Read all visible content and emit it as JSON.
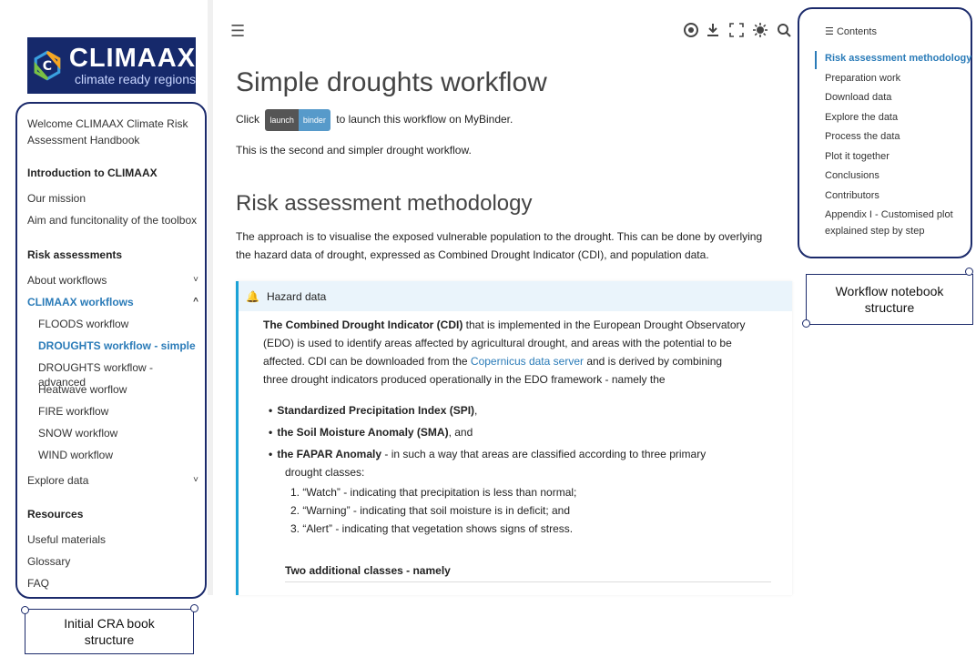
{
  "logo": {
    "title": "CLIMAAX",
    "subtitle": "climate ready regions"
  },
  "sidebar": {
    "items": [
      {
        "label": "Welcome CLIMAAX Climate Risk",
        "style": "normal"
      },
      {
        "label": "Assessment Handbook",
        "style": "normal"
      },
      {
        "label": "Introduction to CLIMAAX",
        "style": "bold"
      },
      {
        "label": "Our mission",
        "style": "normal"
      },
      {
        "label": "Aim and funcitonality of the toolbox",
        "style": "normal"
      },
      {
        "label": "Risk assessments",
        "style": "bold"
      },
      {
        "label": "About workflows",
        "style": "normal"
      },
      {
        "label": "CLIMAAX workflows",
        "style": "active"
      },
      {
        "label": "FLOODS workflow",
        "style": "sub"
      },
      {
        "label": "DROUGHTS workflow - simple",
        "style": "sub-active"
      },
      {
        "label": "DROUGHTS workflow - advanced",
        "style": "sub"
      },
      {
        "label": "Heatwave worflow",
        "style": "sub"
      },
      {
        "label": "FIRE workflow",
        "style": "sub"
      },
      {
        "label": "SNOW workflow",
        "style": "sub"
      },
      {
        "label": "WIND workflow",
        "style": "sub"
      },
      {
        "label": "Explore data",
        "style": "normal"
      },
      {
        "label": "Resources",
        "style": "bold"
      },
      {
        "label": "Useful materials",
        "style": "normal"
      },
      {
        "label": "Glossary",
        "style": "normal"
      },
      {
        "label": "FAQ",
        "style": "normal"
      }
    ]
  },
  "annotations": {
    "left": "Initial CRA book structure",
    "right": "Workflow notebook structure"
  },
  "header": {
    "icons": [
      "menu-icon",
      "github-icon",
      "download-icon",
      "fullscreen-icon",
      "theme-icon",
      "search-icon"
    ]
  },
  "main": {
    "title": "Simple droughts workflow",
    "click_prefix": "Click",
    "binder_left": "launch",
    "binder_right": "binder",
    "click_suffix": "to launch this workflow on MyBinder.",
    "intro": "This is the second and simpler drought workflow.",
    "section_title": "Risk assessment methodology",
    "section_p1": "The approach is to visualise the exposed vulnerable population to the drought. This can be done by overlying",
    "section_p2": "the hazard data of drought, expressed as Combined Drought Indicator (CDI), and population data.",
    "admonition": {
      "title": "Hazard data",
      "line1_bold": "The Combined Drought Indicator (CDI)",
      "line1_rest": " that is implemented in the European Drought Observatory",
      "line2": "(EDO) is used to identify areas affected by agricultural drought, and areas with the potential to be",
      "line3_pre": "affected. CDI can be downloaded from the ",
      "line3_link": "Copernicus data server",
      "line3_post": " and is derived by combining",
      "line4": "three drought indicators produced operationally in the EDO framework - namely the",
      "bullet1_bold": "Standardized Precipitation Index (SPI)",
      "bullet1_rest": ",",
      "bullet2_bold": "the Soil Moisture Anomaly (SMA)",
      "bullet2_rest": ", and",
      "bullet3_bold": "the FAPAR Anomaly",
      "bullet3_rest": " - in such a way that areas are classified according to three primary",
      "bullet3_cont": "drought classes:",
      "num1": "1. “Watch” - indicating that precipitation is less than normal;",
      "num2": "2. “Warning” - indicating that soil moisture is in deficit; and",
      "num3": "3. “Alert” - indicating that vegetation shows signs of stress.",
      "subheading": "Two additional classes - namely"
    }
  },
  "toc": {
    "header": "Contents",
    "items": [
      "Risk assessment methodology",
      "Preparation work",
      "Download data",
      "Explore the data",
      "Process the data",
      "Plot it together",
      "Conclusions",
      "Contributors",
      "Appendix I - Customised plot",
      "explained step by step"
    ]
  },
  "colors": {
    "accent": "#2a7bb8",
    "brand": "#16296b",
    "admonition": "#1ba2d6"
  }
}
